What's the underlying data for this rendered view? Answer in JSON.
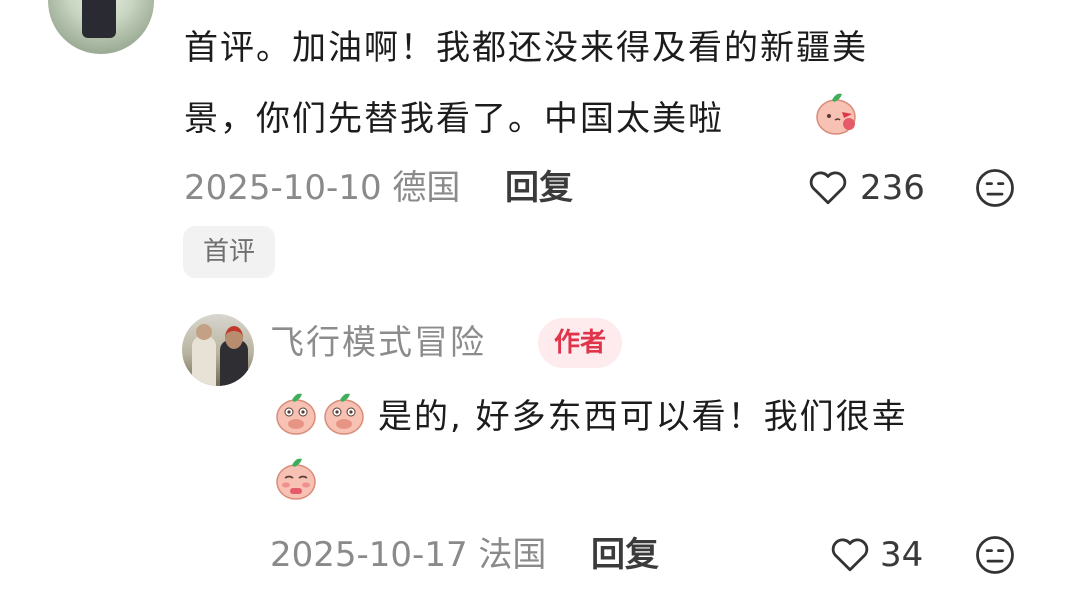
{
  "comment": {
    "line1": "首评。加油啊！我都还没来得及看的新疆美",
    "line2": "景，你们先替我看了。中国太美啦",
    "date": "2025-10-10",
    "location": "德国",
    "reply_label": "回复",
    "likes": "236",
    "tag": "首评",
    "emoji": "peach-blowing-kiss"
  },
  "reply": {
    "author": "飞行模式冒险",
    "badge": "作者",
    "line1": "是的, 好多东西可以看！我们很幸",
    "date": "2025-10-17",
    "location": "法国",
    "reply_label": "回复",
    "likes": "34",
    "emojis": [
      "peach-covering-mouth",
      "peach-covering-mouth",
      "peach-shy"
    ]
  },
  "colors": {
    "badge_text": "#e0344a",
    "badge_bg": "#fdebed",
    "meta": "#8a8a8a",
    "peach": "#f6b4a2"
  }
}
